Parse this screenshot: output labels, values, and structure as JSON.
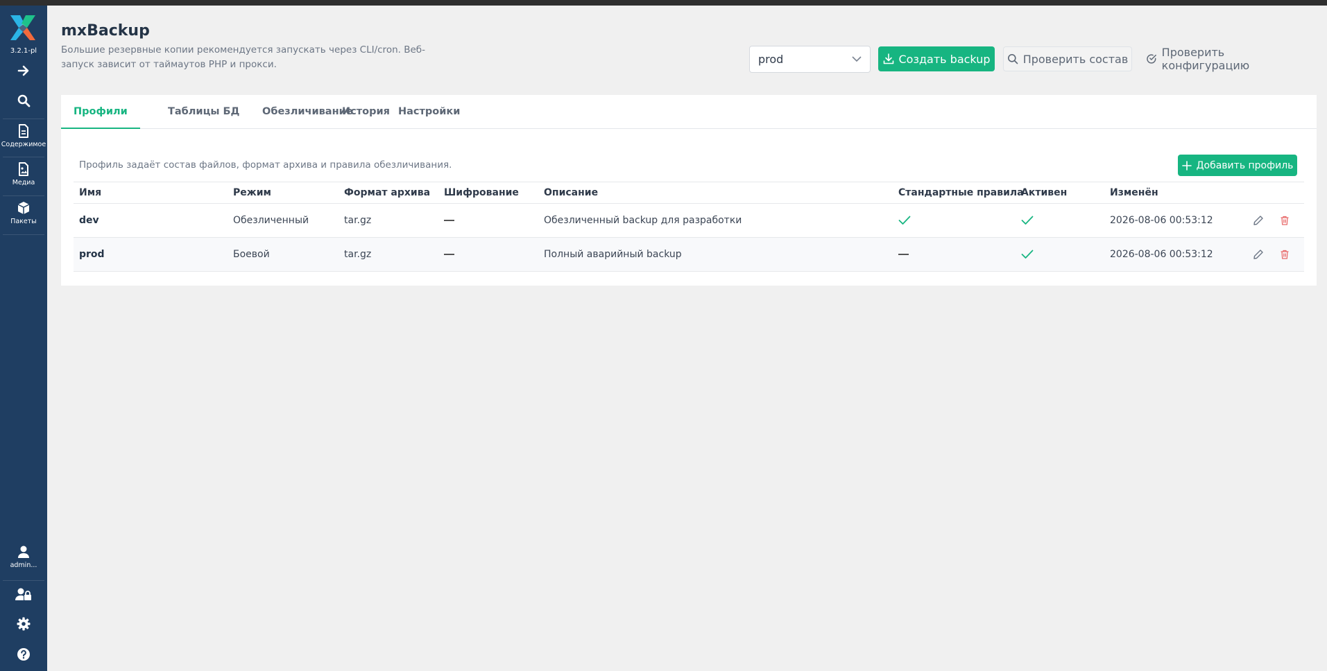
{
  "app": {
    "version": "3.2.1-pl",
    "title": "mxBackup",
    "subtitle": "Большие резервные копии рекомендуется запускать через CLI/cron. Веб-запуск зависит от таймаутов PHP и прокси."
  },
  "sidebar": {
    "items": [
      {
        "label": "Содержимое",
        "icon": "document-icon"
      },
      {
        "label": "Медиа",
        "icon": "image-file-icon"
      },
      {
        "label": "Пакеты",
        "icon": "package-icon"
      }
    ],
    "user_label": "admin..."
  },
  "toolbar": {
    "profile_select": "prod",
    "create_label": "Создать backup",
    "check_label": "Проверить состав",
    "config_label": "Проверить конфигурацию"
  },
  "tabs": [
    "Профили",
    "Таблицы БД",
    "Обезличивание",
    "История",
    "Настройки"
  ],
  "profiles": {
    "hint": "Профиль задаёт состав файлов, формат архива и правила обезличивания.",
    "add_label": "Добавить профиль",
    "columns": [
      "Имя",
      "Режим",
      "Формат архива",
      "Шифрование",
      "Описание",
      "Стандартные правила",
      "Активен",
      "Изменён"
    ],
    "rows": [
      {
        "name": "dev",
        "mode": "Обезличенный",
        "format": "tar.gz",
        "encryption": "—",
        "description": "Обезличенный backup для разработки",
        "standard_rules": true,
        "active": true,
        "modified": "2026-08-06 00:53:12"
      },
      {
        "name": "prod",
        "mode": "Боевой",
        "format": "tar.gz",
        "encryption": "—",
        "description": "Полный аварийный backup",
        "standard_rules": false,
        "active": true,
        "modified": "2026-08-06 00:53:12"
      }
    ]
  },
  "colors": {
    "sidebar": "#1f3e62",
    "accent": "#17b581",
    "danger": "#e86a6a"
  }
}
